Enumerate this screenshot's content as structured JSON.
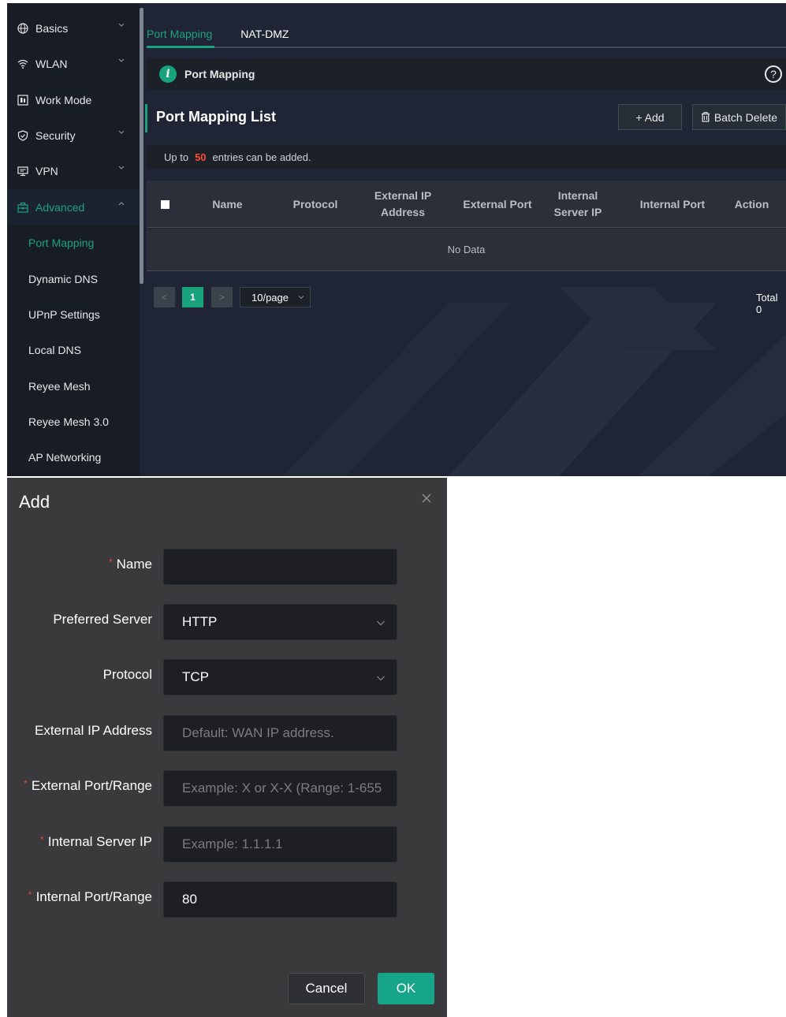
{
  "sidebar": {
    "items": [
      {
        "label": "Basics",
        "icon": "globe-icon",
        "expandable": true
      },
      {
        "label": "WLAN",
        "icon": "wifi-icon",
        "expandable": true
      },
      {
        "label": "Work Mode",
        "icon": "work-mode-icon",
        "expandable": false
      },
      {
        "label": "Security",
        "icon": "shield-icon",
        "expandable": true
      },
      {
        "label": "VPN",
        "icon": "monitor-icon",
        "expandable": true
      },
      {
        "label": "Advanced",
        "icon": "toolbox-icon",
        "expandable": true,
        "expanded": true
      }
    ],
    "sub_items": [
      {
        "label": "Port Mapping",
        "active": true
      },
      {
        "label": "Dynamic DNS"
      },
      {
        "label": "UPnP Settings"
      },
      {
        "label": "Local DNS"
      },
      {
        "label": "Reyee Mesh"
      },
      {
        "label": "Reyee Mesh 3.0"
      },
      {
        "label": "AP Networking"
      }
    ]
  },
  "tabs": [
    {
      "label": "Port Mapping",
      "active": true
    },
    {
      "label": "NAT-DMZ"
    }
  ],
  "info_bar": {
    "text": "Port Mapping"
  },
  "list": {
    "title": "Port Mapping List",
    "add_label": "+ Add",
    "batch_delete_label": "Batch Delete",
    "hint_prefix": "Up to",
    "hint_number": "50",
    "hint_suffix": "entries can be added."
  },
  "table": {
    "columns": [
      "Name",
      "Protocol",
      "External IP Address",
      "External Port",
      "Internal Server IP",
      "Internal Port",
      "Action"
    ],
    "empty_text": "No Data"
  },
  "pagination": {
    "prev": "<",
    "current_page": "1",
    "next": ">",
    "per_page": "10/page",
    "total": "Total 0"
  },
  "dialog": {
    "title": "Add",
    "fields": [
      {
        "label": "Name",
        "required": true,
        "value": "",
        "placeholder": "",
        "type": "text"
      },
      {
        "label": "Preferred Server",
        "required": false,
        "value": "HTTP",
        "type": "select"
      },
      {
        "label": "Protocol",
        "required": false,
        "value": "TCP",
        "type": "select"
      },
      {
        "label": "External IP Address",
        "required": false,
        "value": "",
        "placeholder": "Default: WAN IP address.",
        "type": "text"
      },
      {
        "label": "External Port/Range",
        "required": true,
        "value": "",
        "placeholder": "Example: X or X-X (Range: 1-655",
        "type": "text"
      },
      {
        "label": "Internal Server IP",
        "required": true,
        "value": "",
        "placeholder": "Example: 1.1.1.1",
        "type": "text"
      },
      {
        "label": "Internal Port/Range",
        "required": true,
        "value": "80",
        "type": "text"
      }
    ],
    "cancel_label": "Cancel",
    "ok_label": "OK"
  },
  "colors": {
    "accent": "#19a37c",
    "danger": "#ff4d2e",
    "required_star": "#e5483b"
  }
}
